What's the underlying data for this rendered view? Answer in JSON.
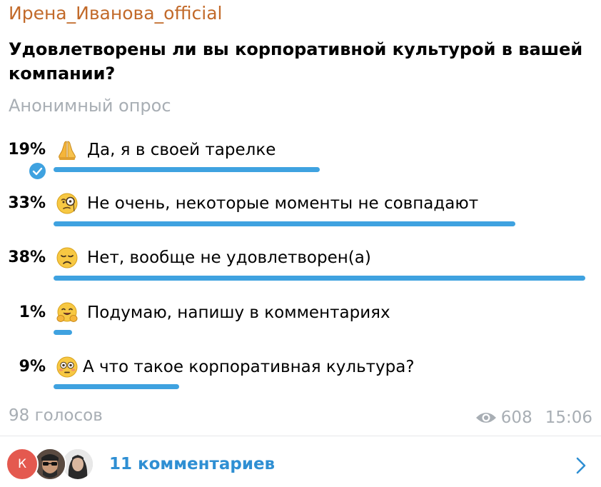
{
  "channel": {
    "author": "Ирена_Иванова_official"
  },
  "poll": {
    "question": "Удовлетворены ли вы корпоративной культурой в вашей компании?",
    "type_label": "Анонимный опрос",
    "options": [
      {
        "percent": "19%",
        "percent_value": 19,
        "emoji": "folded-hands",
        "text": "Да, я в своей тарелке",
        "chosen": true
      },
      {
        "percent": "33%",
        "percent_value": 33,
        "emoji": "monocle-face",
        "text": "Не очень, некоторые моменты не совпадают",
        "chosen": false
      },
      {
        "percent": "38%",
        "percent_value": 38,
        "emoji": "disappointed-face",
        "text": "Нет, вообще не удовлетворен(а)",
        "chosen": false
      },
      {
        "percent": "1%",
        "percent_value": 1,
        "emoji": "hugging-face",
        "text": "Подумаю, напишу в комментариях",
        "chosen": false
      },
      {
        "percent": "9%",
        "percent_value": 9,
        "emoji": "flushed-face",
        "text": "А что такое корпоративная культура?",
        "chosen": false
      }
    ],
    "votes_label": "98 голосов"
  },
  "meta": {
    "views": "608",
    "time": "15:06"
  },
  "comments": {
    "label": "11 комментариев",
    "first_avatar_letter": "К"
  },
  "colors": {
    "author": "#c26a2a",
    "bar": "#3fa2e0",
    "muted": "#a8aeb4",
    "link": "#2f8fd3",
    "avatar_k": "#e4594f"
  }
}
